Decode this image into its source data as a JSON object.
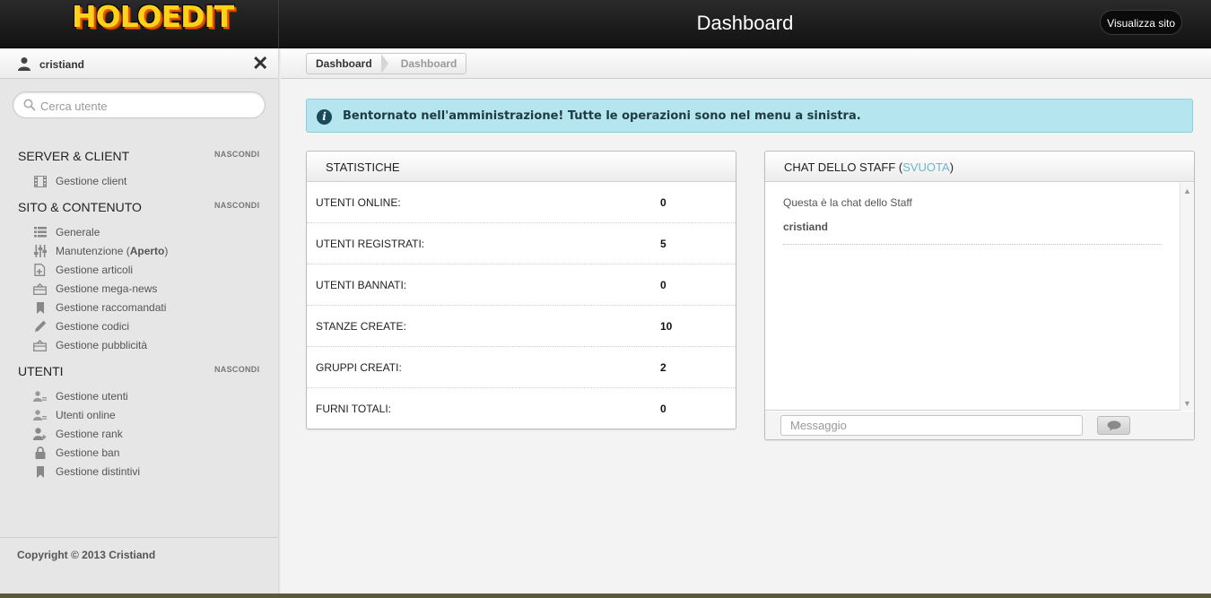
{
  "topbar": {
    "logo_text": "HOLOEDIT",
    "page_title": "Dashboard",
    "view_site_label": "Visualizza sito"
  },
  "user": {
    "name": "cristiand"
  },
  "search": {
    "placeholder": "Cerca utente"
  },
  "sidebar": {
    "hide_label": "NASCONDI",
    "sections": [
      {
        "title": "SERVER & CLIENT",
        "items": [
          {
            "label": "Gestione client",
            "icon": "film-icon"
          }
        ]
      },
      {
        "title": "SITO & CONTENUTO",
        "items": [
          {
            "label": "Generale",
            "icon": "list-icon"
          },
          {
            "label_pre": "Manutenzione (",
            "label_bold": "Aperto",
            "label_post": ")",
            "icon": "sliders-icon"
          },
          {
            "label": "Gestione articoli",
            "icon": "document-add-icon"
          },
          {
            "label": "Gestione mega-news",
            "icon": "briefcase-icon"
          },
          {
            "label": "Gestione raccomandati",
            "icon": "bookmark-icon"
          },
          {
            "label": "Gestione codici",
            "icon": "pencil-icon"
          },
          {
            "label": "Gestione pubblicità",
            "icon": "briefcase-icon"
          }
        ]
      },
      {
        "title": "UTENTI",
        "items": [
          {
            "label": "Gestione utenti",
            "icon": "users-icon"
          },
          {
            "label": "Utenti online",
            "icon": "users-icon"
          },
          {
            "label": "Gestione rank",
            "icon": "user-add-icon"
          },
          {
            "label": "Gestione ban",
            "icon": "lock-icon"
          },
          {
            "label": "Gestione distintivi",
            "icon": "bookmark-icon"
          }
        ]
      }
    ],
    "copyright": "Copyright © 2013 Cristiand"
  },
  "breadcrumb": [
    "Dashboard",
    "Dashboard"
  ],
  "info_banner": {
    "text": "Bentornato nell'amministrazione! Tutte le operazioni sono nel menu a sinistra."
  },
  "stats": {
    "title": "STATISTICHE",
    "rows": [
      {
        "label": "UTENTI ONLINE:",
        "value": "0"
      },
      {
        "label": "UTENTI REGISTRATI:",
        "value": "5"
      },
      {
        "label": "UTENTI BANNATI:",
        "value": "0"
      },
      {
        "label": "STANZE CREATE:",
        "value": "10"
      },
      {
        "label": "GRUPPI CREATI:",
        "value": "2"
      },
      {
        "label": "FURNI TOTALI:",
        "value": "0"
      }
    ]
  },
  "chat": {
    "title_pre": "CHAT DELLO STAFF (",
    "title_link": "SVUOTA",
    "title_post": ")",
    "intro": "Questa è la chat dello Staff",
    "messages": [
      {
        "user": "cristiand"
      }
    ],
    "input_placeholder": "Messaggio"
  },
  "colors": {
    "accent_link": "#6db5c9",
    "info_bg": "#b5e5ee",
    "logo_yellow": "#ffd21a"
  }
}
